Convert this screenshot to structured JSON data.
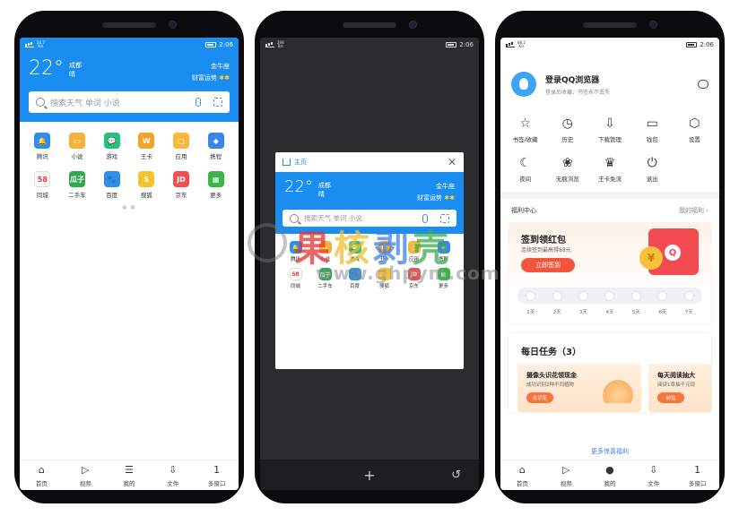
{
  "status": {
    "time": "2:06",
    "left_a": "24.7",
    "left_a_unit": "K/s",
    "left_b": "298",
    "left_b_unit": "B/s",
    "left_c": "88.2",
    "left_c_unit": "K/s"
  },
  "weather": {
    "temp": "22°",
    "city": "成都",
    "condition": "晴",
    "sign": "金牛座",
    "fortune": "财富运势",
    "stars": "✱✱"
  },
  "search": {
    "placeholder": "搜索天气 单词 小说"
  },
  "apps": [
    {
      "label": "腾讯",
      "glyph": "🔔",
      "color": "#2f8ee8"
    },
    {
      "label": "小说",
      "glyph": "▭",
      "color": "#f5b23a"
    },
    {
      "label": "游戏",
      "glyph": "💬",
      "color": "#27c07c"
    },
    {
      "label": "王卡",
      "glyph": "W",
      "color": "#f6a12a"
    },
    {
      "label": "应用",
      "glyph": "▢",
      "color": "#f6b73a"
    },
    {
      "label": "携程",
      "glyph": "◆",
      "color": "#3a86e6"
    },
    {
      "label": "同城",
      "glyph": "58",
      "color": "#ffffff"
    },
    {
      "label": "二手车",
      "glyph": "瓜子",
      "color": "#2fa84f"
    },
    {
      "label": "百度",
      "glyph": "🐾",
      "color": "#2f8ee8"
    },
    {
      "label": "搜狐",
      "glyph": "S",
      "color": "#f6c32a"
    },
    {
      "label": "京东",
      "glyph": "JD",
      "color": "#ef4f4f"
    },
    {
      "label": "更多",
      "glyph": "▦",
      "color": "#39b54a"
    }
  ],
  "home_nav": [
    {
      "label": "首页",
      "glyph": "⌂"
    },
    {
      "label": "视频",
      "glyph": "▷"
    },
    {
      "label": "我的",
      "glyph": "☰"
    },
    {
      "label": "文件",
      "glyph": "⇩"
    },
    {
      "label": "多窗口",
      "glyph": "1"
    }
  ],
  "multiwindow": {
    "tab_title": "主页",
    "close": "✕",
    "add": "+",
    "back": "↺"
  },
  "menu": {
    "login_title": "登录QQ浏览器",
    "login_sub": "登录后收藏、书签永不丢失",
    "items": [
      {
        "label": "书签/收藏",
        "glyph": "☆"
      },
      {
        "label": "历史",
        "glyph": "◷"
      },
      {
        "label": "下载管理",
        "glyph": "⇩"
      },
      {
        "label": "钱包",
        "glyph": "▭"
      },
      {
        "label": "设置",
        "glyph": "⬡"
      },
      {
        "label": "夜间",
        "glyph": "☾"
      },
      {
        "label": "无痕浏览",
        "glyph": "❀"
      },
      {
        "label": "王卡免流",
        "glyph": "♛"
      },
      {
        "label": "退出",
        "glyph": "⏻"
      }
    ],
    "welfare": "福利中心",
    "my_welfare": "我的福利 ›",
    "redpack_title": "签到领红包",
    "redpack_sub": "连续签到最高得88元",
    "checkin_button": "立即签到",
    "coin": "¥",
    "q": "Q",
    "days": [
      "1天",
      "2天",
      "3天",
      "4天",
      "5天",
      "6天",
      "7天"
    ],
    "task_title": "每日任务（3）",
    "task1_title": "摄像头识花领现金",
    "task1_sub": "成功识别2种不同植物",
    "task1_btn": "去识花",
    "task2_title": "每天阅读抽大",
    "task2_sub": "阅读1章抽千元现",
    "task2_btn": "前往",
    "more": "更多惊喜福利"
  },
  "menu_nav": [
    {
      "label": "首页",
      "glyph": "⌂"
    },
    {
      "label": "视频",
      "glyph": "▷"
    },
    {
      "label": "我的",
      "glyph": "●"
    },
    {
      "label": "文件",
      "glyph": "⇩"
    },
    {
      "label": "多窗口",
      "glyph": "1"
    }
  ],
  "watermark": {
    "text": "果核剥壳",
    "url": "www.ghpym.com"
  }
}
